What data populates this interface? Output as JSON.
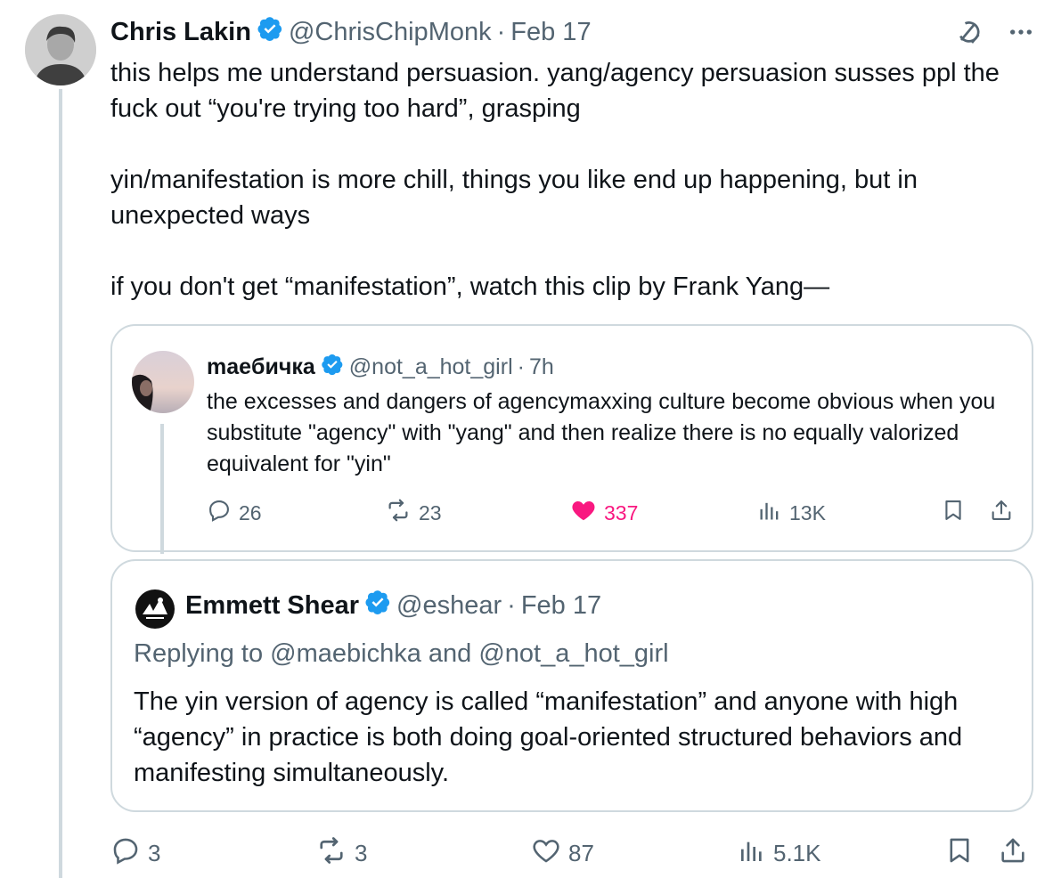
{
  "main_tweet": {
    "author_name": "Chris Lakin",
    "handle": "@ChrisChipMonk",
    "separator": "·",
    "date": "Feb 17",
    "paragraphs": [
      "this helps me understand persuasion. yang/agency persuasion susses ppl the fuck out “you're trying too hard”, grasping",
      "yin/manifestation is more chill, things you like end up happening, but in unexpected ways",
      "if you don't get “manifestation”, watch this clip by Frank Yang—"
    ],
    "actions": {
      "replies": "3",
      "reposts": "3",
      "likes": "87",
      "views": "5.1K"
    }
  },
  "quoted_tweet": {
    "author_name": "maeбичка",
    "handle": "@not_a_hot_girl",
    "separator": "·",
    "time": "7h",
    "text": "the excesses and dangers of agencymaxxing culture become obvious when you substitute \"agency\" with \"yang\" and then realize there is no equally valorized equivalent for \"yin\"",
    "actions": {
      "replies": "26",
      "reposts": "23",
      "likes": "337",
      "views": "13K"
    }
  },
  "reply_tweet": {
    "author_name": "Emmett Shear",
    "handle": "@eshear",
    "separator": "·",
    "date": "Feb 17",
    "replying_to": "Replying to @maebichka and @not_a_hot_girl",
    "text": "The yin version of agency is called “manifestation” and anyone with high “agency” in practice is both doing goal-oriented structured behaviors and manifesting simultaneously."
  },
  "colors": {
    "verified": "#1d9bf0",
    "muted": "#536471",
    "like_active": "#f91880",
    "border": "#cfd9de"
  },
  "icons": [
    "verified-badge-icon",
    "grok-icon",
    "more-icon",
    "reply-icon",
    "repost-icon",
    "like-icon",
    "views-icon",
    "bookmark-icon",
    "share-icon"
  ]
}
